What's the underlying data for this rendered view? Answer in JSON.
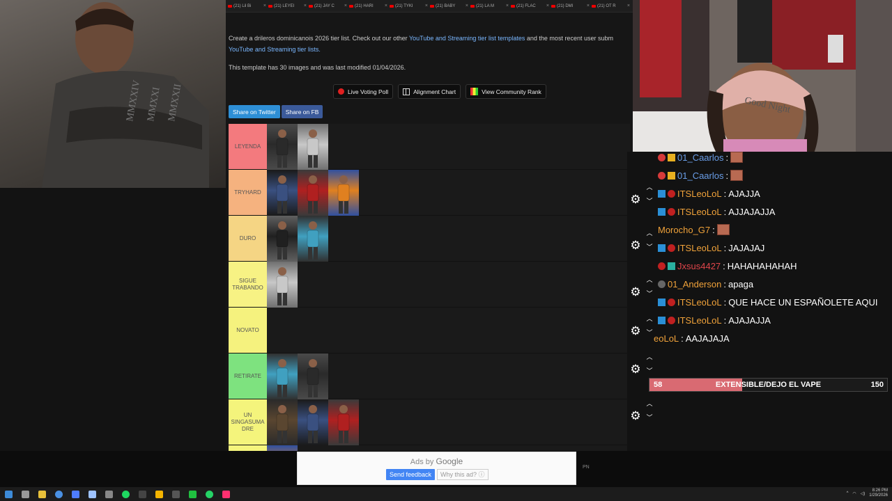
{
  "browser": {
    "tabs": [
      "(21) Lil Bi",
      "(21) LEYEI",
      "(21) JAY C",
      "(21) HARI",
      "(21) TYKI",
      "(21) BABY",
      "(21) LA M",
      "(21) FLAC",
      "(21) DMI",
      "(21) OT R"
    ],
    "description": {
      "text_1": "Create a drileros dominicanois 2026 tier list. Check out our other ",
      "link_1": "YouTube and Streaming tier list templates",
      "text_2": " and the most recent user subm",
      "link_2": "YouTube and Streaming tier lists."
    },
    "modified": "This template has 30 images and was last modified 01/04/2026.",
    "actions": {
      "live_voting": "Live Voting Poll",
      "alignment": "Alignment Chart",
      "community": "View Community Rank"
    },
    "share": {
      "twitter": "Share on Twitter",
      "facebook": "Share on FB"
    },
    "tiers": [
      {
        "label": "LEYENDA",
        "color": "#f37a7e",
        "image_count": 2
      },
      {
        "label": "TRYHARD",
        "color": "#f5b27f",
        "image_count": 3
      },
      {
        "label": "DURO",
        "color": "#f5d584",
        "image_count": 2
      },
      {
        "label": "SIGUE TRABANDO",
        "color": "#f7f284",
        "image_count": 1
      },
      {
        "label": "NOVATO",
        "color": "#f5f27e",
        "image_count": 0
      },
      {
        "label": "RETIRATE",
        "color": "#7ee27f",
        "image_count": 2
      },
      {
        "label": "UN SINGASUMA DRE",
        "color": "#f4f47c",
        "image_count": 3
      },
      {
        "label": "",
        "color": "#f4f47c",
        "image_count": 1
      }
    ]
  },
  "chat": {
    "messages": [
      {
        "name": "01_Caarlos",
        "name_color": "#6a9ee8",
        "text": "",
        "emote": true
      },
      {
        "name": "01_Caarlos",
        "name_color": "#6a9ee8",
        "text": "",
        "emote": true
      },
      {
        "name": "ITSLeoLoL",
        "name_color": "#f0a23a",
        "text": "AJAJJA"
      },
      {
        "name": "ITSLeoLoL",
        "name_color": "#f0a23a",
        "text": "AJJAJAJJA"
      },
      {
        "name": "Morocho_G7",
        "name_color": "#f0a23a",
        "text": "",
        "emote": true
      },
      {
        "name": "ITSLeoLoL",
        "name_color": "#f0a23a",
        "text": "JAJAJAJ"
      },
      {
        "name": "Jxsus4427",
        "name_color": "#e0454a",
        "text": "HAHAHAHAHAH"
      },
      {
        "name": "01_Anderson",
        "name_color": "#f0a23a",
        "text": "apaga"
      },
      {
        "name": "ITSLeoLoL",
        "name_color": "#f0a23a",
        "text": "QUE HACE UN ESPAÑOLETE AQUI"
      },
      {
        "name": "ITSLeoLoL",
        "name_color": "#f0a23a",
        "text": "AJAJAJJA"
      },
      {
        "name": "eoLoL",
        "name_color": "#f0a23a",
        "text": "AAJAJAJA"
      }
    ],
    "separator": ":",
    "goal": {
      "current": "58",
      "label": "EXTENSIBLE/DEJO EL VAPE",
      "max": "150",
      "progress": 0.39,
      "fill_color": "#d96a72"
    }
  },
  "ad": {
    "ads_by": "Ads by",
    "google": "Google",
    "send_feedback": "Send feedback",
    "why": "Why this ad? ⓘ",
    "side": "PN"
  },
  "taskbar": {
    "icons": [
      "windows-icon",
      "search-icon",
      "file-explorer-icon",
      "chrome-icon",
      "app-icon",
      "steam-icon",
      "pen-icon",
      "spotify-icon",
      "terminal-icon",
      "chrome-canary-icon",
      "obs-icon",
      "green-app-icon",
      "whatsapp-icon",
      "twitch-icon"
    ],
    "icon_colors": [
      "#3d8bd8",
      "#999",
      "#e8c13a",
      "#4a90e2",
      "#4e7cff",
      "#9ec3ff",
      "#888",
      "#1ed760",
      "#444",
      "#f4b400",
      "#555",
      "#20c040",
      "#25d366",
      "#ff3070"
    ],
    "time": "8:26 PM",
    "date": "1/29/2026"
  }
}
